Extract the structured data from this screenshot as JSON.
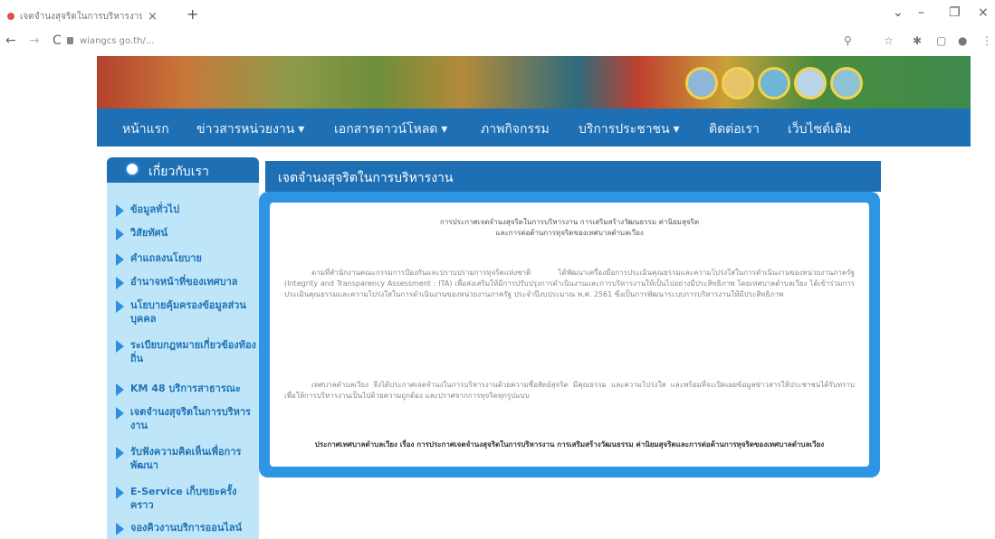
{
  "browser": {
    "tab_title": "เจตจำนงสุจริตในการบริหารงาน",
    "tab_close": "×",
    "new_tab": "+",
    "url": "wiangcs go.th/...",
    "controls": [
      "⌄",
      "–",
      "❐",
      "×"
    ],
    "nav": [
      "←",
      "→",
      "C"
    ]
  },
  "menu": {
    "items": [
      "หน้าแรก",
      "ข่าวสารหน่วยงาน ▾",
      "เอกสารดาวน์โหลด ▾",
      "ภาพกิจกรรม",
      "บริการประชาชน ▾",
      "ติดต่อเรา",
      "เว็บไซต์เดิม"
    ]
  },
  "sidebar": {
    "heading": "เกี่ยวกับเรา",
    "items": [
      "ข้อมูลทั่วไป",
      "วิสัยทัศน์",
      "คำแถลงนโยบาย",
      "อำนาจหน้าที่ของเทศบาล",
      "นโยบายคุ้มครองข้อมูลส่วนบุคคล",
      "ระเบียบกฎหมายเกี่ยวข้องท้องถิ่น",
      "KM 48 บริการสาธารณะ",
      "เจตจำนงสุจริตในการบริหารงาน",
      "รับฟังความคิดเห็นเพื่อการพัฒนา",
      "E-Service เก็บขยะครั้งคราว",
      "จองคิวงานบริการออนไลน์"
    ]
  },
  "main": {
    "heading": "เจตจำนงสุจริตในการบริหารงาน",
    "title_line1": "การประกาศเจตจำนงสุจริตในการบริหารงาน การเสริมสร้างวัฒนธรรม ค่านิยมสุจริต",
    "title_line2": "และการต่อต้านการทุจริตของเทศบาลตำบลเวียง",
    "paragraph1": "ตามที่สำนักงานคณะกรรมการป้องกันและปราบปรามการทุจริตแห่งชาติ ได้พัฒนาเครื่องมือการประเมินคุณธรรมและความโปร่งใสในการดำเนินงานของหน่วยงานภาครัฐ (Integrity and Transparency Assessment : ITA) เพื่อส่งเสริมให้มีการปรับปรุงการดำเนินงานและการบริหารงานให้เป็นไปอย่างมีประสิทธิภาพ โดยเทศบาลตำบลเวียง ได้เข้าร่วมการประเมินคุณธรรมและความโปร่งใสในการดำเนินงานของหน่วยงานภาครัฐ ประจำปีงบประมาณ พ.ศ. 2561 ซึ่งเป็นการพัฒนาระบบการบริหารงานให้มีประสิทธิภาพ",
    "paragraph2": "เทศบาลตำบลเวียง จึงได้ประกาศเจตจำนงในการบริหารงานด้วยความซื่อสัตย์สุจริต มีคุณธรรม และความโปร่งใส และพร้อมที่จะเปิดเผยข้อมูลข่าวสารให้ประชาชนได้รับทราบ เพื่อให้การบริหารงานเป็นไปด้วยความถูกต้อง และปราศจากการทุจริตทุกรูปแบบ",
    "footer": "ประกาศเทศบาลตำบลเวียง เรื่อง การประกาศเจตจำนงสุจริตในการบริหารงาน การเสริมสร้างวัฒนธรรม ค่านิยมสุจริตและการต่อต้านการทุจริตของเทศบาลตำบลเวียง"
  },
  "colors": {
    "menubar": "#1f6fb5",
    "sidebar_bg": "#bfe6f8",
    "sidebar_text": "#1f73b8",
    "frame": "#2e95e4"
  }
}
